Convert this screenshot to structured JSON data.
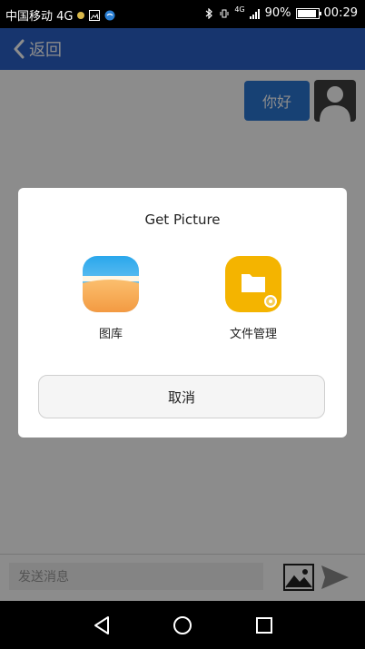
{
  "status_bar": {
    "carrier": "中国移动 4G",
    "network": "4G",
    "battery": "90%",
    "battery_level": 0.9,
    "time": "00:29"
  },
  "app_bar": {
    "back_label": "返回"
  },
  "chat": {
    "messages": [
      {
        "text": "你好",
        "from": "me"
      }
    ]
  },
  "input_bar": {
    "placeholder": "发送消息"
  },
  "dialog": {
    "title": "Get Picture",
    "options": [
      {
        "label": "图库"
      },
      {
        "label": "文件管理"
      }
    ],
    "cancel_label": "取消"
  },
  "colors": {
    "app_bar": "#2a61c8",
    "bubble": "#2b77d3",
    "gallery_top": "#4bb8f0",
    "gallery_bottom": "#f7a552",
    "file_manager": "#f4b400"
  }
}
